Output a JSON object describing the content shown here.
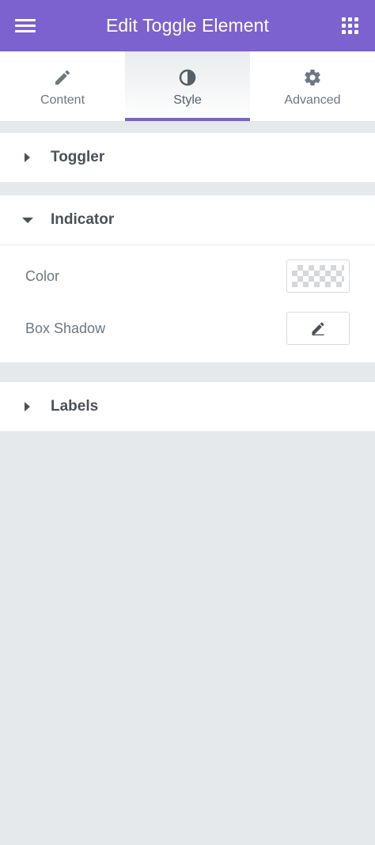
{
  "header": {
    "title": "Edit Toggle Element",
    "menu_icon": "hamburger-icon",
    "apps_icon": "grid-icon",
    "background": "#7c62cf"
  },
  "tabs": [
    {
      "label": "Content",
      "icon": "pencil-icon",
      "active": false
    },
    {
      "label": "Style",
      "icon": "half-circle-icon",
      "active": true
    },
    {
      "label": "Advanced",
      "icon": "gear-icon",
      "active": false
    }
  ],
  "sections": {
    "toggler": {
      "title": "Toggler",
      "expanded": false
    },
    "indicator": {
      "title": "Indicator",
      "expanded": true,
      "controls": {
        "color_label": "Color",
        "box_shadow_label": "Box Shadow"
      }
    },
    "labels": {
      "title": "Labels",
      "expanded": false
    }
  },
  "colors": {
    "accent": "#7c62cf",
    "panel_bg": "#e6e9ec",
    "text": "#4a5158"
  }
}
